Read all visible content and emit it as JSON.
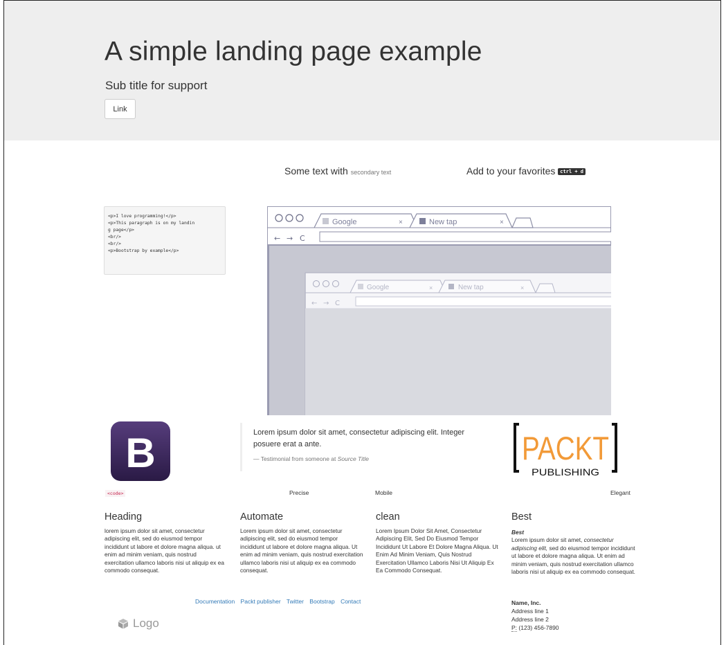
{
  "jumbotron": {
    "title": "A simple landing page example",
    "subtitle": "Sub title for support",
    "button": "Link"
  },
  "row1": {
    "text": "Some text with",
    "secondary": "secondary text",
    "favorites": "Add to your favorites",
    "kbd": "ctrl + d"
  },
  "code_block": "<p>I love programming!</p>\n<p>This paragraph is on my landin\ng page</p>\n<br/>\n<br/>\n<p>Bootstrap by example</p>",
  "browser": {
    "outer_tab1": "Google",
    "outer_tab2": "New tap",
    "inner_tab1": "Google",
    "inner_tab2": "New tap"
  },
  "logos": {
    "bootstrap_letter": "B",
    "packt": "PACKT",
    "publishing": "PUBLISHING"
  },
  "testimonial": {
    "quote": "Lorem ipsum dolor sit amet, consectetur adipiscing elit. Integer posuere erat a ante.",
    "footer_prefix": "— Testimonial from someone at",
    "source": "Source Title"
  },
  "labels": {
    "code": "<code>",
    "precise": "Precise",
    "mobile": "Mobile",
    "elegant": "Elegant"
  },
  "columns": [
    {
      "heading": "Heading",
      "text": "lorem ipsum dolor sit amet, consectetur adipiscing elit, sed do eiusmod tempor incididunt ut labore et dolore magna aliqua. ut enim ad minim veniam, quis nostrud exercitation ullamco laboris nisi ut aliquip ex ea commodo consequat."
    },
    {
      "heading": "Automate",
      "text": "Lorem ipsum dolor sit amet, consectetur adipiscing elit, sed do eiusmod tempor incididunt ut labore et dolore magna aliqua. Ut enim ad minim veniam, quis nostrud exercitation ullamco laboris nisi ut aliquip ex ea commodo consequat."
    },
    {
      "heading": "clean",
      "text": "Lorem Ipsum Dolor Sit Amet, Consectetur Adipiscing Elit, Sed Do Eiusmod Tempor Incididunt Ut Labore Et Dolore Magna Aliqua. Ut Enim Ad Minim Veniam, Quis Nostrud Exercitation Ullamco Laboris Nisi Ut Aliquip Ex Ea Commodo Consequat."
    },
    {
      "heading": "Best",
      "subheading": "Best",
      "text_a": "Lorem ipsum dolor sit amet,",
      "text_b": "consectetur",
      "text_c": "adipiscing elit,",
      "text_d": "sed do eiusmod tempor incididunt ut labore et dolore magna aliqua. Ut enim ad minim veniam, quis nostrud exercitation ullamco laboris nisi ut aliquip ex ea commodo consequat."
    }
  ],
  "footer": {
    "links": [
      "Documentation",
      "Packt publisher",
      "Twitter",
      "Bootstrap",
      "Contact"
    ],
    "logo": "Logo"
  },
  "address": {
    "name": "Name, Inc.",
    "line1": "Address line 1",
    "line2": "Address line 2",
    "phone_label": "P:",
    "phone": "(123) 456-7890"
  }
}
